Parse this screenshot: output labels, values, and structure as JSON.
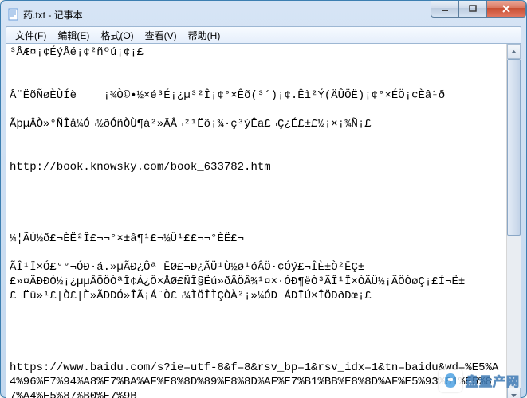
{
  "window": {
    "title": "药.txt - 记事本"
  },
  "menu": {
    "file": "文件(F)",
    "edit": "编辑(E)",
    "format": "格式(O)",
    "view": "查看(V)",
    "help": "帮助(H)"
  },
  "content": "³ÅÆ¤¡¢ÉýÅé¡¢²ñºú¡¢¡£\n\n\nÅ¨ËõÑøÈÙÍè    ¡¾Ò©•½×é³É¡¿µ³²Î¡¢°×Êõ(³´)¡¢.Êì²Ý(ÄÛÖË)¡¢°×ÉÖ¡¢Èâ¹ð\n\nÃþµÂÒ»°ÑÎå¼Ó¬½ðÓñÒÙ¶à²»ÄÂ¬²¹Ëõ¡¾·ç³ýÊa£¬Ç¿É£±£½¡×¡¾Ñ¡£\n\n\nhttp://book.knowsky.com/book_633782.htm\n\n\n\n\n¼¦ÃÚ½ð£¬ÈË²Î£¬¬°×±â¶¹£¬½Û¹££¬¬°ÈË£¬\n\nÃÎ¹Ï×Ó£°°¬ÓÐ·á.»µÃÐ¿Ôª ËØ£¬Ð¿ÃÜ¹Ù½ø¹óÂÖ·¢Óý£¬ÎÈ±Ò²ËÇ±\n£»¤ÃÐÐÓ½¡¿µµÂÖÖÒªÎ¢Á¿Ô×ÅØ£ÑÎ§Ëú»ðÂÖÂ¾¹¤×·ÓÐ¶ëÒ³ÃÎ¹Ï×ÓÃÜ½¡ÃÖÒøÇ¡£Í¬Ë±\n£¬Ëü»¹£|Ò£|È»ÃÐÐÓ»ÎÃ¡Á¨Ò£¬¼ÌÖÎÌÇÒÀ²¡»¼ÓÐ ÁÐÏÚ×ÎÖÐðÐœ¡£\n\n\n\n\nhttps://www.baidu.com/s?ie=utf-8&f=8&rsv_bp=1&rsv_idx=1&tn=baidu&wd=%E5%A4%96%E7%94%A8%E7%BA%AF%E8%8D%89%E8%8D%AF%E7%B1%BB%E8%8D%AF%E5%93%81%E5%87%A4%E5%87%B0%E7%9B",
  "watermark": {
    "text": "盘量产网"
  }
}
